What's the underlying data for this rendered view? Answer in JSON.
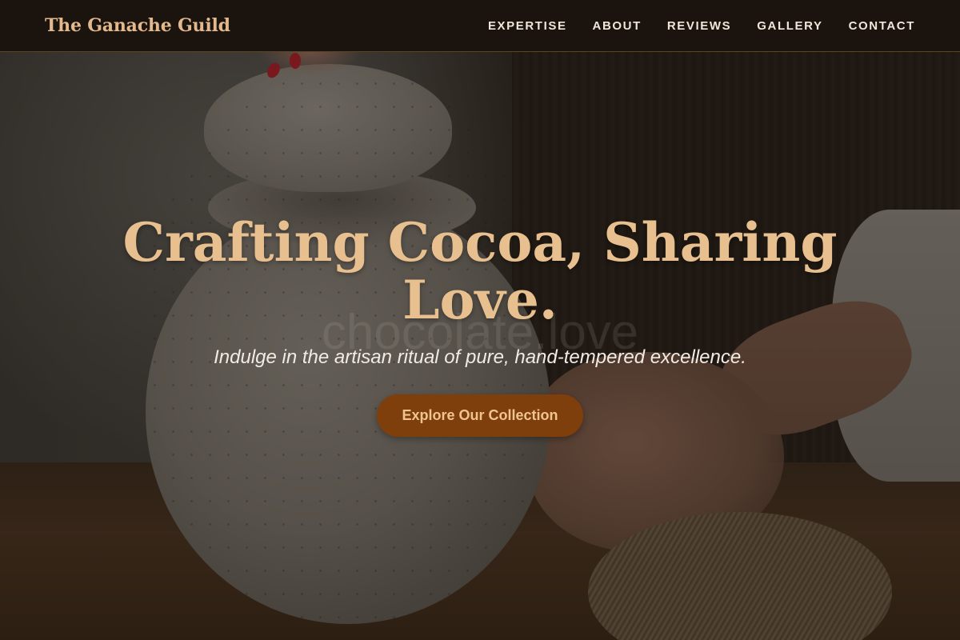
{
  "header": {
    "brand": "The Ganache Guild",
    "nav": [
      {
        "label": "EXPERTISE"
      },
      {
        "label": "ABOUT"
      },
      {
        "label": "REVIEWS"
      },
      {
        "label": "GALLERY"
      },
      {
        "label": "CONTACT"
      }
    ]
  },
  "hero": {
    "title": "Crafting Cocoa, Sharing Love.",
    "subtitle": "Indulge in the artisan ritual of pure, hand-tempered excellence.",
    "cta_label": "Explore Our Collection",
    "watermark": "chocolate.love"
  },
  "colors": {
    "brand": "#e2b98d",
    "title": "#e8bf8f",
    "cta_background": "#7e3f0c",
    "cta_text": "#f0c48f",
    "header_background": "#1b130d"
  },
  "icons": []
}
